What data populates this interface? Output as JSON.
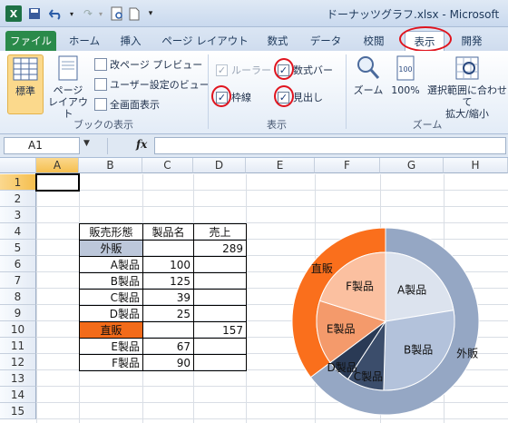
{
  "titlebar": {
    "title": "ドーナッツグラフ.xlsx - Microsoft",
    "app_icon": "X"
  },
  "tabs": [
    {
      "id": "file",
      "label": "ファイル"
    },
    {
      "id": "home",
      "label": "ホーム"
    },
    {
      "id": "insert",
      "label": "挿入"
    },
    {
      "id": "pagelayout",
      "label": "ページ レイアウト"
    },
    {
      "id": "formulas",
      "label": "数式"
    },
    {
      "id": "data",
      "label": "データ"
    },
    {
      "id": "review",
      "label": "校閲"
    },
    {
      "id": "view",
      "label": "表示"
    },
    {
      "id": "dev",
      "label": "開発"
    }
  ],
  "ribbon": {
    "book_views": {
      "group_label": "ブックの表示",
      "normal": "標準",
      "page_layout_1": "ページ",
      "page_layout_2": "レイアウト",
      "page_break": "改ページ プレビュー",
      "custom_view": "ユーザー設定のビュー",
      "full_screen": "全画面表示"
    },
    "show": {
      "group_label": "表示",
      "ruler": "ルーラー",
      "formula_bar": "数式バー",
      "gridlines": "枠線",
      "headings": "見出し"
    },
    "zoom": {
      "group_label": "ズーム",
      "zoom": "ズーム",
      "zoom100": "100%",
      "zoom_sel_1": "選択範囲に合わせて",
      "zoom_sel_2": "拡大/縮小"
    }
  },
  "formula_bar": {
    "name_box": "A1",
    "fx": "fx",
    "value": ""
  },
  "columns": [
    "A",
    "B",
    "C",
    "D",
    "E",
    "F",
    "G",
    "H"
  ],
  "rows": [
    "1",
    "2",
    "3",
    "4",
    "5",
    "6",
    "7",
    "8",
    "9",
    "10",
    "11",
    "12",
    "13",
    "14",
    "15"
  ],
  "table": {
    "headers": [
      "販売形態",
      "製品名",
      "売上"
    ],
    "rows": [
      {
        "type": "外販",
        "name": "",
        "value": "289"
      },
      {
        "type": "",
        "name": "A製品",
        "value": "100"
      },
      {
        "type": "",
        "name": "B製品",
        "value": "125"
      },
      {
        "type": "",
        "name": "C製品",
        "value": "39"
      },
      {
        "type": "",
        "name": "D製品",
        "value": "25"
      },
      {
        "type": "直販",
        "name": "",
        "value": "157"
      },
      {
        "type": "",
        "name": "E製品",
        "value": "67"
      },
      {
        "type": "",
        "name": "F製品",
        "value": "90"
      }
    ]
  },
  "chart_data": {
    "type": "pie",
    "subtype": "sunburst-style double doughnut",
    "outer": {
      "categories": [
        "外販",
        "直販"
      ],
      "values": [
        289,
        157
      ],
      "colors": [
        "#95a7c4",
        "#fa6f1c"
      ]
    },
    "inner": {
      "categories": [
        "A製品",
        "B製品",
        "C製品",
        "D製品",
        "E製品",
        "F製品"
      ],
      "values": [
        100,
        125,
        39,
        25,
        67,
        90
      ],
      "colors": [
        "#dce3ee",
        "#b3c2db",
        "#3b4d6b",
        "#2a3a55",
        "#f49a6b",
        "#fbc0a0"
      ]
    }
  },
  "colors": {
    "outside_sales": "#bcc7da",
    "direct_sales": "#f26b1a",
    "highlight": "#e0141e"
  }
}
